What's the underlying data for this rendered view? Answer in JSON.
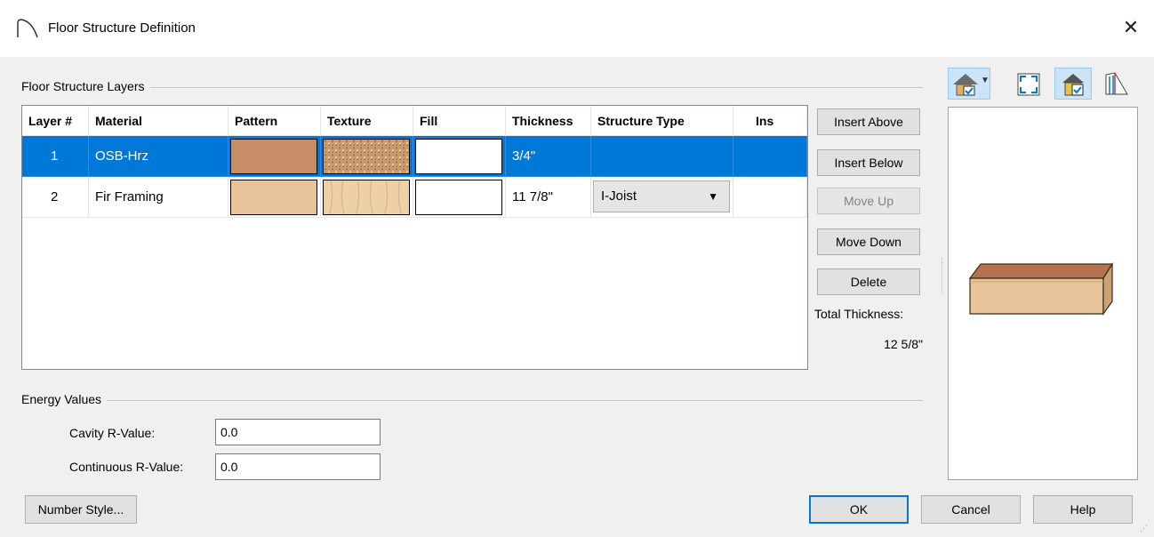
{
  "window": {
    "title": "Floor Structure Definition",
    "close_glyph": "✕"
  },
  "layers_group": {
    "label": "Floor Structure Layers"
  },
  "table": {
    "headers": [
      "Layer #",
      "Material",
      "Pattern",
      "Texture",
      "Fill",
      "Thickness",
      "Structure Type",
      "Ins"
    ],
    "rows": [
      {
        "layer": "1",
        "material": "OSB-Hrz",
        "pattern_color": "#c68d66",
        "texture": "osb",
        "fill_color": "#ffffff",
        "thickness": "3/4\"",
        "structure_type": ""
      },
      {
        "layer": "2",
        "material": "Fir Framing",
        "pattern_color": "#e9c49a",
        "texture": "wood",
        "fill_color": "#ffffff",
        "thickness": "11 7/8\"",
        "structure_type": "I-Joist"
      }
    ],
    "selected_color": "#0078d7"
  },
  "side_buttons": {
    "insert_above": "Insert Above",
    "insert_below": "Insert Below",
    "move_up": "Move Up",
    "move_down": "Move Down",
    "delete": "Delete"
  },
  "total": {
    "label": "Total Thickness:",
    "value": "12 5/8\""
  },
  "energy": {
    "label": "Energy Values",
    "cavity_label": "Cavity R-Value:",
    "cavity_value": "0.0",
    "continuous_label": "Continuous R-Value:",
    "continuous_value": "0.0"
  },
  "footer": {
    "number_style": "Number Style...",
    "ok": "OK",
    "cancel": "Cancel",
    "help": "Help"
  },
  "toolbar_icons": [
    "house-view-icon",
    "dropdown-arrow-icon",
    "fill-window-icon",
    "show-colors-icon",
    "show-patterns-icon"
  ]
}
